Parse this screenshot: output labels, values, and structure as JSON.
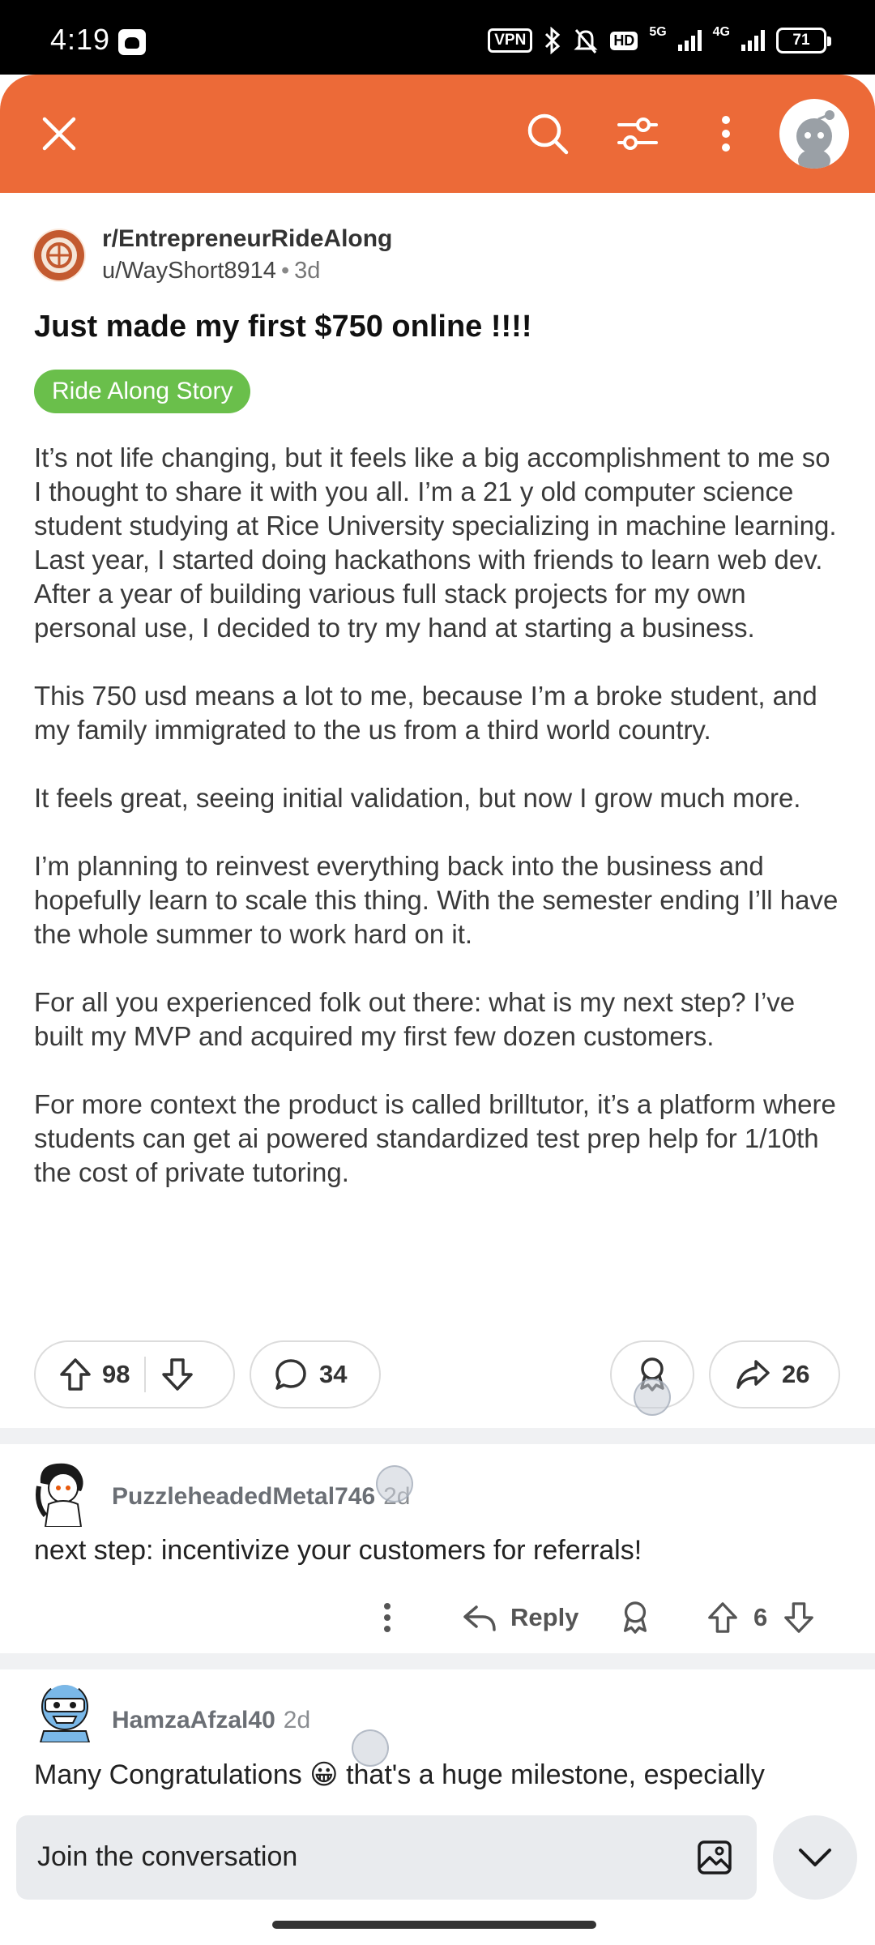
{
  "status_bar": {
    "time": "4:19",
    "vpn": "VPN",
    "hd": "HD",
    "network_5g": "5G",
    "network_4g": "4G",
    "battery": "71"
  },
  "app_bar": {
    "icons": [
      "close-icon",
      "search-icon",
      "filter-icon",
      "more-vertical-icon",
      "user-avatar"
    ],
    "color": "#ec6a38"
  },
  "post": {
    "subreddit": "r/EntrepreneurRideAlong",
    "author": "u/WayShort8914",
    "separator": "•",
    "age": "3d",
    "title": "Just made my first $750 online !!!!",
    "flair": "Ride Along Story",
    "flair_color": "#6abf4b",
    "paragraphs": [
      "It’s not life changing, but it feels like a big accomplishment to me so I thought to share it with you all. I’m a 21 y old computer science student studying at Rice University specializing in machine learning. Last year, I started doing hackathons with friends to learn web dev. After a year of building various full stack projects for my own personal use, I decided to try my hand at starting a business.",
      "This 750 usd means a lot to me, because I’m a broke student, and my family immigrated to the us from a third world country.",
      "It feels great, seeing initial validation, but now I grow much more.",
      "I’m planning to reinvest everything back into the business and hopefully learn to scale this thing. With the semester ending I’ll have the whole summer to work hard on it.",
      "For all you experienced folk out there: what is my next step? I’ve built my MVP and acquired my first few dozen customers.",
      "For more context the product is called brilltutor, it’s a platform where students can get ai powered standardized test prep help for 1/10th the cost of private tutoring."
    ],
    "upvotes": "98",
    "comments": "34",
    "shares": "26"
  },
  "comments": [
    {
      "author": "PuzzleheadedMetal746",
      "age": "2d",
      "text": "next step: incentivize your customers for referrals!",
      "reply_label": "Reply",
      "score": "6"
    },
    {
      "author": "HamzaAfzal40",
      "age": "2d",
      "text": "Many Congratulations 😀 that's a huge milestone, especially"
    }
  ],
  "composer": {
    "placeholder": "Join the conversation"
  }
}
